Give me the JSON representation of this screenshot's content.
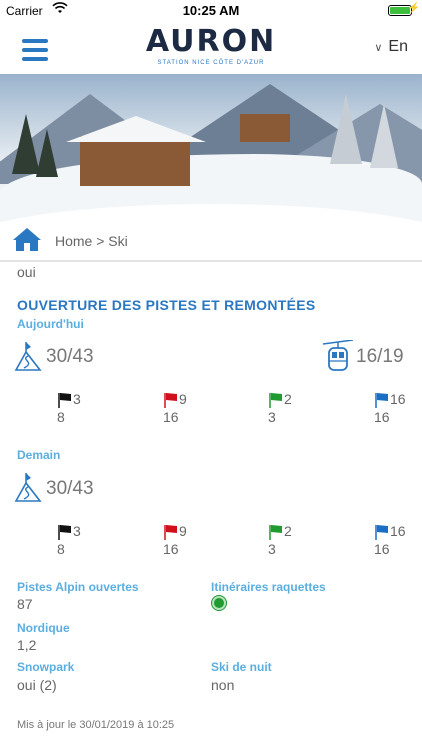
{
  "status_bar": {
    "carrier": "Carrier",
    "time": "10:25 AM"
  },
  "header": {
    "logo_text": "AURON",
    "logo_sub": "STATION  NICE CÔTE D'AZUR",
    "language": "En"
  },
  "breadcrumb": {
    "text": "Home > Ski"
  },
  "previous_value": "oui",
  "section_title": "OUVERTURE DES PISTES ET REMONTÉES",
  "today": {
    "label": "Aujourd'hui",
    "pistes_open": "30/43",
    "lifts_open": "16/19",
    "flags": [
      {
        "color": "#111111",
        "open": "3",
        "total": "8"
      },
      {
        "color": "#d0101c",
        "open": "9",
        "total": "16"
      },
      {
        "color": "#1f9b32",
        "open": "2",
        "total": "3"
      },
      {
        "color": "#1a6fc4",
        "open": "16",
        "total": "16"
      }
    ]
  },
  "tomorrow": {
    "label": "Demain",
    "pistes_open": "30/43",
    "flags": [
      {
        "color": "#111111",
        "open": "3",
        "total": "8"
      },
      {
        "color": "#d0101c",
        "open": "9",
        "total": "16"
      },
      {
        "color": "#1f9b32",
        "open": "2",
        "total": "3"
      },
      {
        "color": "#1a6fc4",
        "open": "16",
        "total": "16"
      }
    ]
  },
  "details": {
    "alpine_label": "Pistes Alpin ouvertes",
    "alpine_value": "87",
    "snowshoe_label": "Itinéraires raquettes",
    "snowshoe_status_color": "#1f9b32",
    "nordic_label": "Nordique",
    "nordic_value": "1,2",
    "snowpark_label": "Snowpark",
    "snowpark_value": "oui (2)",
    "night_ski_label": "Ski de nuit",
    "night_ski_value": "non"
  },
  "updated": "Mis à jour le 30/01/2019 à 10:25",
  "colors": {
    "accent": "#2b78c2",
    "sub_label": "#5aaee0"
  }
}
